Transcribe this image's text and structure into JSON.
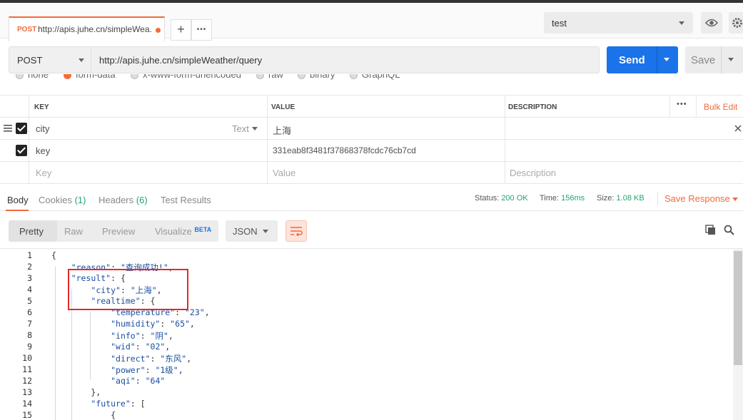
{
  "tab": {
    "method": "POST",
    "title": "http://apis.juhe.cn/simpleWea...",
    "add_label": "+",
    "more_label": "•••"
  },
  "environment": {
    "selected": "test"
  },
  "request": {
    "method": "POST",
    "url": "http://apis.juhe.cn/simpleWeather/query",
    "send_label": "Send",
    "save_label": "Save"
  },
  "body_types": [
    "none",
    "form-data",
    "x-www-form-urlencoded",
    "raw",
    "binary",
    "GraphQL"
  ],
  "params_table": {
    "headers": {
      "key": "KEY",
      "value": "VALUE",
      "description": "DESCRIPTION",
      "bulk_edit": "Bulk Edit",
      "more": "•••"
    },
    "rows": [
      {
        "key": "city",
        "type": "Text",
        "value": "上海",
        "description": ""
      },
      {
        "key": "key",
        "type": "",
        "value": "331eab8f3481f37868378fcdc76cb7cd",
        "description": ""
      }
    ],
    "placeholders": {
      "key": "Key",
      "value": "Value",
      "description": "Description"
    }
  },
  "response_tabs": {
    "body": "Body",
    "cookies": "Cookies",
    "cookies_count": "(1)",
    "headers": "Headers",
    "headers_count": "(6)",
    "test_results": "Test Results"
  },
  "response_meta": {
    "status_label": "Status:",
    "status_value": "200 OK",
    "time_label": "Time:",
    "time_value": "156ms",
    "size_label": "Size:",
    "size_value": "1.08 KB",
    "save_response": "Save Response"
  },
  "response_views": {
    "pretty": "Pretty",
    "raw": "Raw",
    "preview": "Preview",
    "visualize": "Visualize",
    "beta": "BETA",
    "format": "JSON"
  },
  "code_lines": [
    {
      "n": "1",
      "text": "{"
    },
    {
      "n": "2",
      "text": "    \"reason\": \"查询成功!\","
    },
    {
      "n": "3",
      "text": "    \"result\": {"
    },
    {
      "n": "4",
      "text": "        \"city\": \"上海\","
    },
    {
      "n": "5",
      "text": "        \"realtime\": {"
    },
    {
      "n": "6",
      "text": "            \"temperature\": \"23\","
    },
    {
      "n": "7",
      "text": "            \"humidity\": \"65\","
    },
    {
      "n": "8",
      "text": "            \"info\": \"阴\","
    },
    {
      "n": "9",
      "text": "            \"wid\": \"02\","
    },
    {
      "n": "10",
      "text": "            \"direct\": \"东风\","
    },
    {
      "n": "11",
      "text": "            \"power\": \"1级\","
    },
    {
      "n": "12",
      "text": "            \"aqi\": \"64\""
    },
    {
      "n": "13",
      "text": "        },"
    },
    {
      "n": "14",
      "text": "        \"future\": ["
    },
    {
      "n": "15",
      "text": "            {"
    }
  ],
  "colors": {
    "accent": "#f26b3a",
    "send": "#1a73e8",
    "status_ok": "#25a36d",
    "highlight": "#e8262d"
  }
}
